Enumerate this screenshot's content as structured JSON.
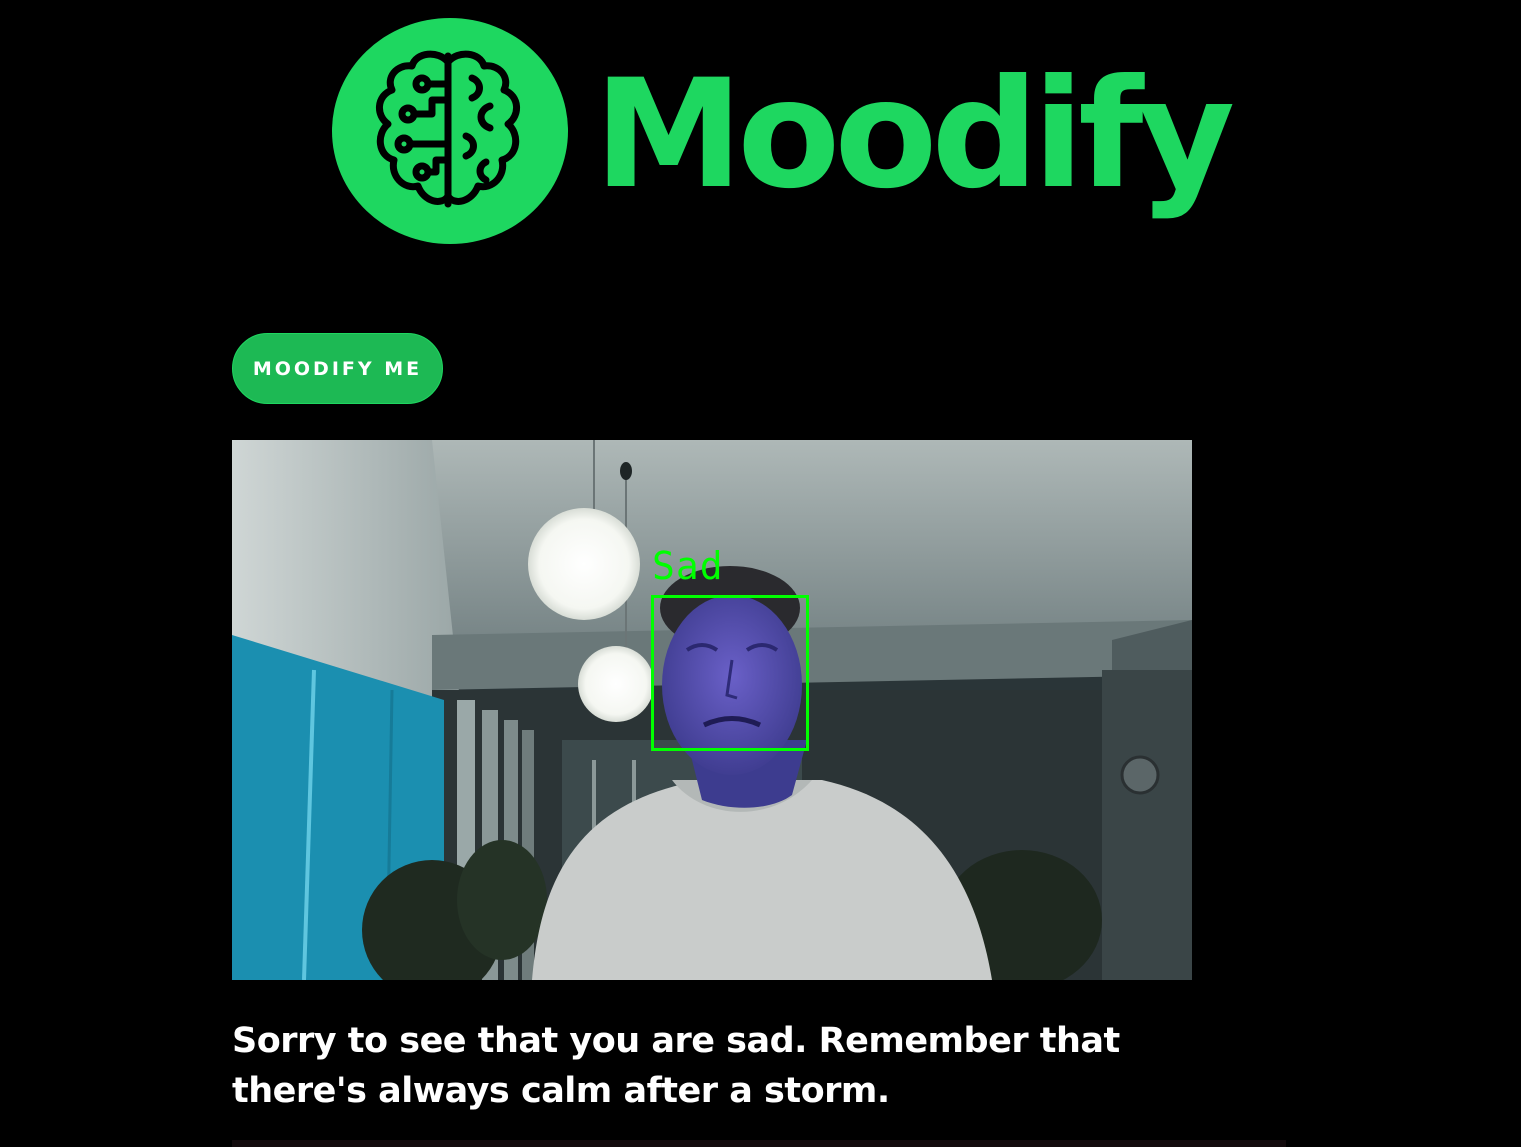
{
  "brand": {
    "name": "Moodify",
    "color": "#1ed760",
    "logo_icon": "brain-circuit-icon"
  },
  "actions": {
    "primary_label": "MOODIFY ME",
    "primary_color": "#1db954"
  },
  "webcam": {
    "detected_emotion": "Sad",
    "box_color": "#00ff00"
  },
  "result": {
    "message": "Sorry to see that you are sad. Remember that there's always calm after a storm."
  },
  "colors": {
    "background": "#000000",
    "text": "#ffffff"
  }
}
